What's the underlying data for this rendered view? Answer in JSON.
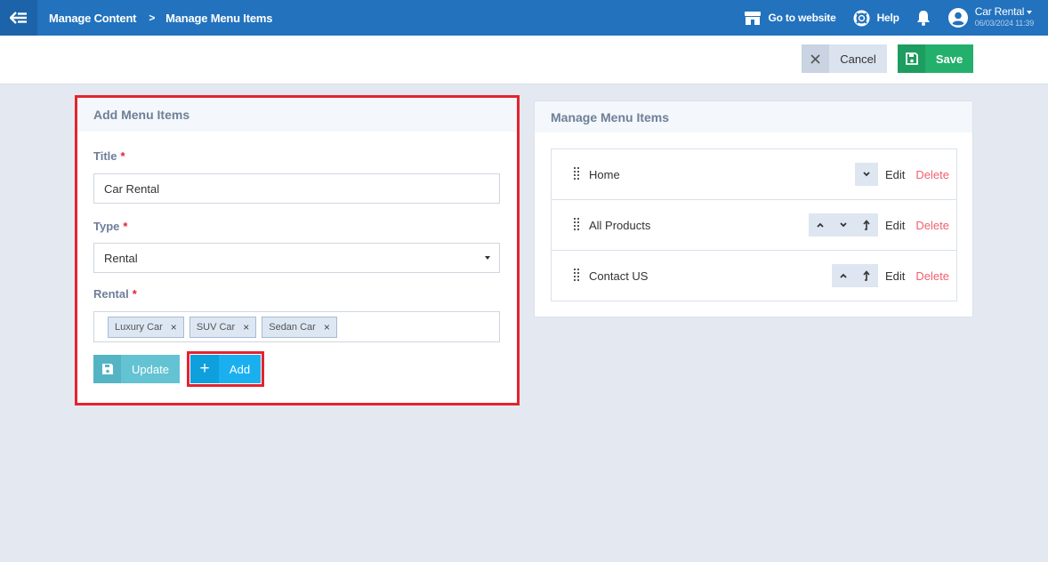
{
  "topbar": {
    "breadcrumb": [
      "Manage Content",
      "Manage Menu Items"
    ],
    "breadcrumb_separator": ">",
    "go_to_website": "Go to website",
    "help": "Help",
    "user_name": "Car Rental",
    "user_datetime": "06/03/2024 11:39",
    "bg_color": "#2272be"
  },
  "actions": {
    "cancel_label": "Cancel",
    "save_label": "Save"
  },
  "add_panel": {
    "heading": "Add Menu Items",
    "title_label": "Title",
    "title_value": "Car Rental",
    "type_label": "Type",
    "type_value": "Rental",
    "rental_label": "Rental",
    "rental_tags": [
      "Luxury Car",
      "SUV Car",
      "Sedan Car"
    ],
    "required_mark": "*",
    "tag_remove": "×",
    "update_label": "Update",
    "add_label": "Add",
    "add_symbol": "+"
  },
  "manage_panel": {
    "heading": "Manage Menu Items",
    "edit_label": "Edit",
    "delete_label": "Delete",
    "items": [
      {
        "title": "Home",
        "arrows": [
          "down"
        ]
      },
      {
        "title": "All Products",
        "arrows": [
          "up",
          "down",
          "out"
        ]
      },
      {
        "title": "Contact US",
        "arrows": [
          "up",
          "out"
        ]
      }
    ]
  },
  "colors": {
    "highlight": "#e4232f",
    "save_green": "#23b06c",
    "add_blue": "#1ab0f0",
    "update_teal": "#63c3d3",
    "delete_red": "#f06070"
  }
}
